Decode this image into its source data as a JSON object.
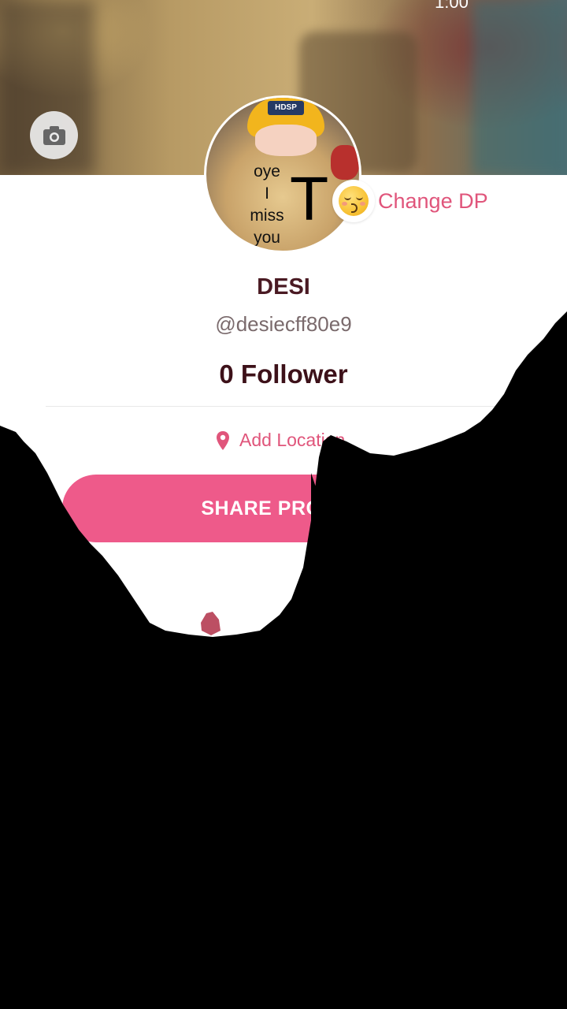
{
  "status_bar": {
    "time": "1:00"
  },
  "profile": {
    "name": "DESI",
    "handle": "@desiecff80e9",
    "followers": "0 Follower",
    "change_dp_label": "Change DP",
    "avatar_text": {
      "hat_tag": "HDSP",
      "line1": "oye",
      "line2": "I",
      "line3": "miss",
      "line4": "you",
      "big_letter": "T"
    }
  },
  "location": {
    "label": "Add Location"
  },
  "actions": {
    "share_label": "SHARE PROFILE"
  },
  "colors": {
    "accent": "#e0557b",
    "share_button": "#ee5a8a",
    "name": "#4a1a23",
    "follower": "#3d1119"
  },
  "icons": [
    "camera-icon",
    "kissing-emoji-icon",
    "map-pin-icon"
  ]
}
